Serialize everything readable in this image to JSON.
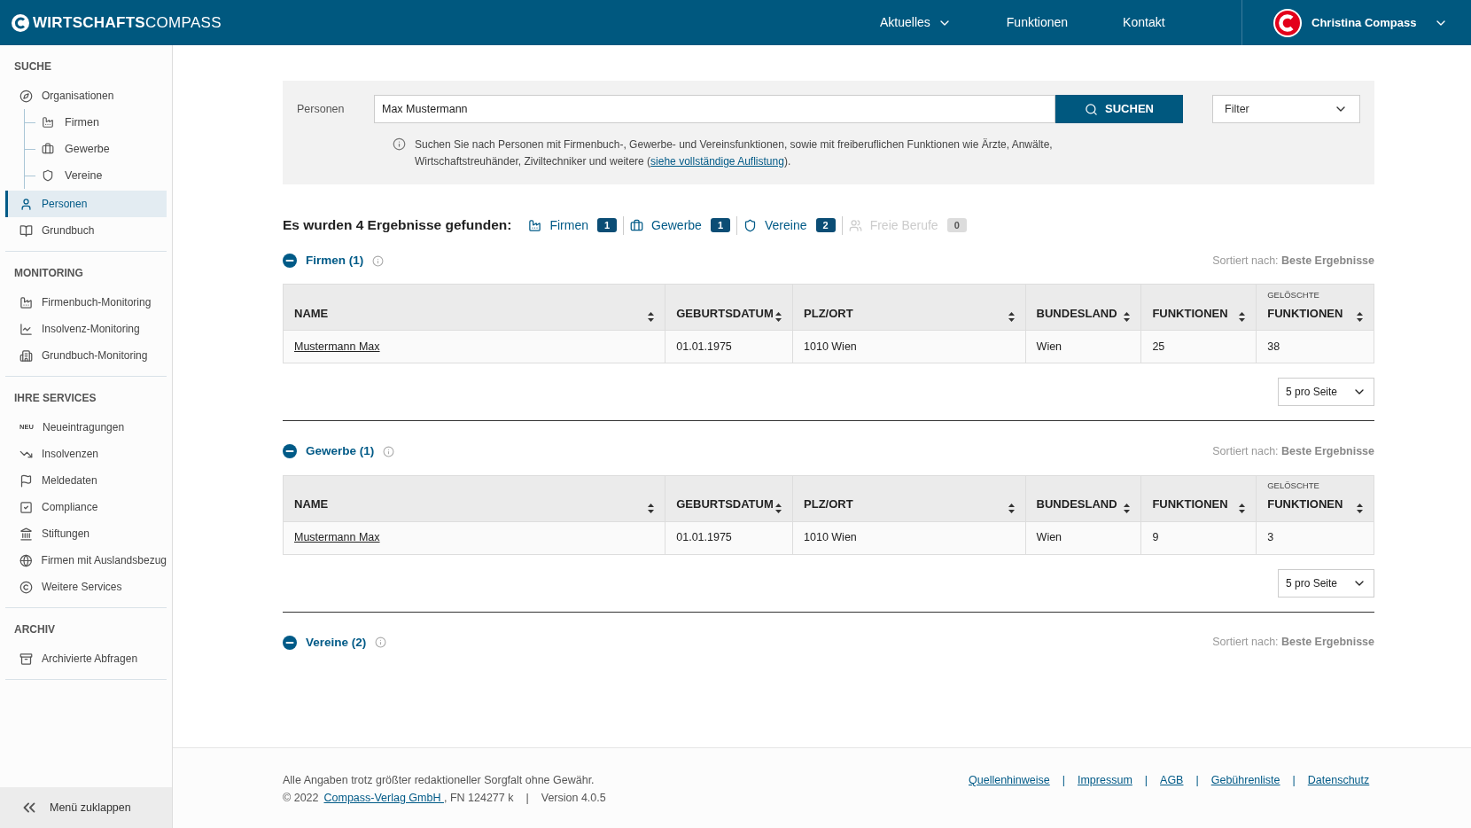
{
  "header": {
    "brand_bold": "WIRTSCHAFTS",
    "brand_light": "COMPASS",
    "nav": [
      {
        "label": "Aktuelles",
        "dropdown": true
      },
      {
        "label": "Funktionen",
        "dropdown": false
      },
      {
        "label": "Kontakt",
        "dropdown": false
      }
    ],
    "user": {
      "name": "Christina Compass"
    }
  },
  "sidebar": {
    "sections": [
      {
        "title": "SUCHE",
        "items": [
          {
            "label": "Organisationen",
            "selected": false,
            "children": [
              {
                "label": "Firmen",
                "selected": false
              },
              {
                "label": "Gewerbe",
                "selected": false
              },
              {
                "label": "Vereine",
                "selected": false
              }
            ]
          },
          {
            "label": "Personen",
            "selected": true
          },
          {
            "label": "Grundbuch",
            "selected": false
          }
        ]
      },
      {
        "title": "MONITORING",
        "items": [
          {
            "label": "Firmenbuch-Monitoring",
            "selected": false
          },
          {
            "label": "Insolvenz-Monitoring",
            "selected": false
          },
          {
            "label": "Grundbuch-Monitoring",
            "selected": false
          }
        ]
      },
      {
        "title": "IHRE SERVICES",
        "items": [
          {
            "label": "Neueintragungen",
            "selected": false,
            "badge": "NEU"
          },
          {
            "label": "Insolvenzen",
            "selected": false
          },
          {
            "label": "Meldedaten",
            "selected": false
          },
          {
            "label": "Compliance",
            "selected": false
          },
          {
            "label": "Stiftungen",
            "selected": false
          },
          {
            "label": "Firmen mit Auslandsbezug",
            "selected": false
          },
          {
            "label": "Weitere Services",
            "selected": false
          }
        ]
      },
      {
        "title": "ARCHIV",
        "items": [
          {
            "label": "Archivierte Abfragen",
            "selected": false
          }
        ]
      }
    ],
    "collapse": "Menü zuklappen"
  },
  "search": {
    "label": "Personen",
    "value": "Max Mustermann",
    "button": "SUCHEN",
    "filter": "Filter",
    "hint_before": "Suchen Sie nach Personen mit Firmenbuch-, Gewerbe- und Vereinsfunktionen, sowie mit freiberuflichen Funktionen wie Ärzte, Anwälte, Wirtschaftstreuhänder, Ziviltechniker und weitere (",
    "hint_link": "siehe vollständige Auflistung",
    "hint_after": ")."
  },
  "summary": {
    "title": "Es wurden 4 Ergebnisse gefunden:",
    "categories": [
      {
        "label": "Firmen",
        "count": "1",
        "disabled": false
      },
      {
        "label": "Gewerbe",
        "count": "1",
        "disabled": false
      },
      {
        "label": "Vereine",
        "count": "2",
        "disabled": false
      },
      {
        "label": "Freie Berufe",
        "count": "0",
        "disabled": true
      }
    ]
  },
  "sections": [
    {
      "title": "Firmen (1)",
      "expanded": true,
      "sort_label": "Sortiert nach:",
      "sort_value": "Beste Ergebnisse",
      "per_page": "5 pro Seite",
      "table": {
        "columns": [
          {
            "label": "NAME"
          },
          {
            "label": "GEBURTSDATUM"
          },
          {
            "label": "PLZ/ORT"
          },
          {
            "label": "BUNDESLAND"
          },
          {
            "label": "FUNKTIONEN"
          },
          {
            "label": "FUNKTIONEN",
            "sup": "GELÖSCHTE"
          }
        ],
        "rows": [
          [
            "Mustermann Max",
            "01.01.1975",
            "1010 Wien",
            "Wien",
            "25",
            "38"
          ]
        ]
      }
    },
    {
      "title": "Gewerbe (1)",
      "expanded": true,
      "sort_label": "Sortiert nach:",
      "sort_value": "Beste Ergebnisse",
      "per_page": "5 pro Seite",
      "table": {
        "columns": [
          {
            "label": "NAME"
          },
          {
            "label": "GEBURTSDATUM"
          },
          {
            "label": "PLZ/ORT"
          },
          {
            "label": "BUNDESLAND"
          },
          {
            "label": "FUNKTIONEN"
          },
          {
            "label": "FUNKTIONEN",
            "sup": "GELÖSCHTE"
          }
        ],
        "rows": [
          [
            "Mustermann Max",
            "01.01.1975",
            "1010 Wien",
            "Wien",
            "9",
            "3"
          ]
        ]
      }
    },
    {
      "title": "Vereine (2)",
      "expanded": true,
      "sort_label": "Sortiert nach:",
      "sort_value": "Beste Ergebnisse"
    }
  ],
  "footer": {
    "disclaimer": "Alle Angaben trotz größter redaktioneller Sorgfalt ohne Gewähr.",
    "copyright": "© 2022",
    "company": "Compass-Verlag GmbH ",
    "register": ", FN 124277 k",
    "separator": "|",
    "version": "Version 4.0.5",
    "links": [
      "Quellenhinweise",
      "Impressum",
      "AGB",
      "Gebührenliste",
      "Datenschutz"
    ]
  }
}
